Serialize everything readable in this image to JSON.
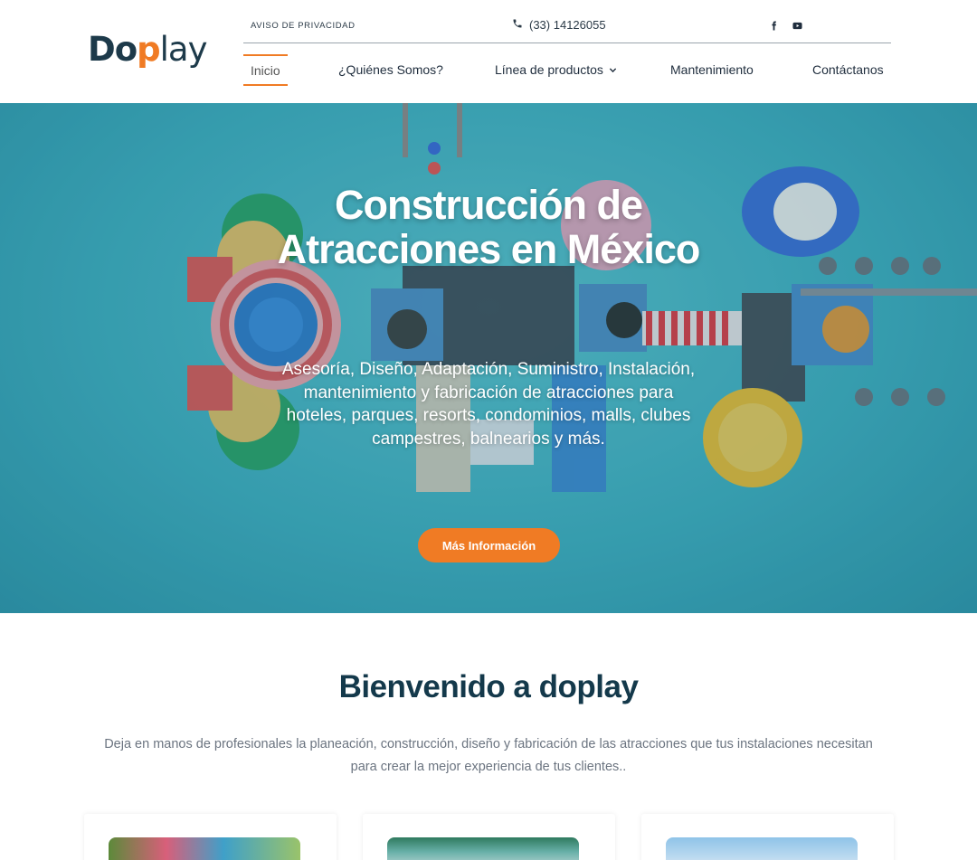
{
  "header": {
    "logo": {
      "part1": "Do",
      "part2": "p",
      "part3": "lay"
    },
    "privacy_link": "AVISO DE PRIVACIDAD",
    "phone": "(33) 14126055",
    "social": [
      "facebook-icon",
      "youtube-icon"
    ],
    "nav": [
      {
        "label": "Inicio",
        "active": true
      },
      {
        "label": "¿Quiénes Somos?"
      },
      {
        "label": "Línea de productos",
        "has_dropdown": true
      },
      {
        "label": "Mantenimiento"
      },
      {
        "label": "Contáctanos"
      }
    ]
  },
  "hero": {
    "title": "Construcción de Atracciones en México",
    "subtitle": "Asesoría, Diseño, Adaptación, Suministro, Instalación, mantenimiento y fabricación de atracciones para hoteles, parques, resorts, condominios, malls, clubes campestres, balnearios y más.",
    "button": "Más Información"
  },
  "welcome": {
    "title": "Bienvenido a doplay",
    "text": "Deja en manos de profesionales la planeación, construcción, diseño y fabricación de las atracciones que tus instalaciones necesitan para crear la mejor experiencia de tus clientes.."
  },
  "colors": {
    "accent": "#f07b24",
    "brand_dark": "#14394b",
    "hero_water": "#3fb2c4"
  }
}
